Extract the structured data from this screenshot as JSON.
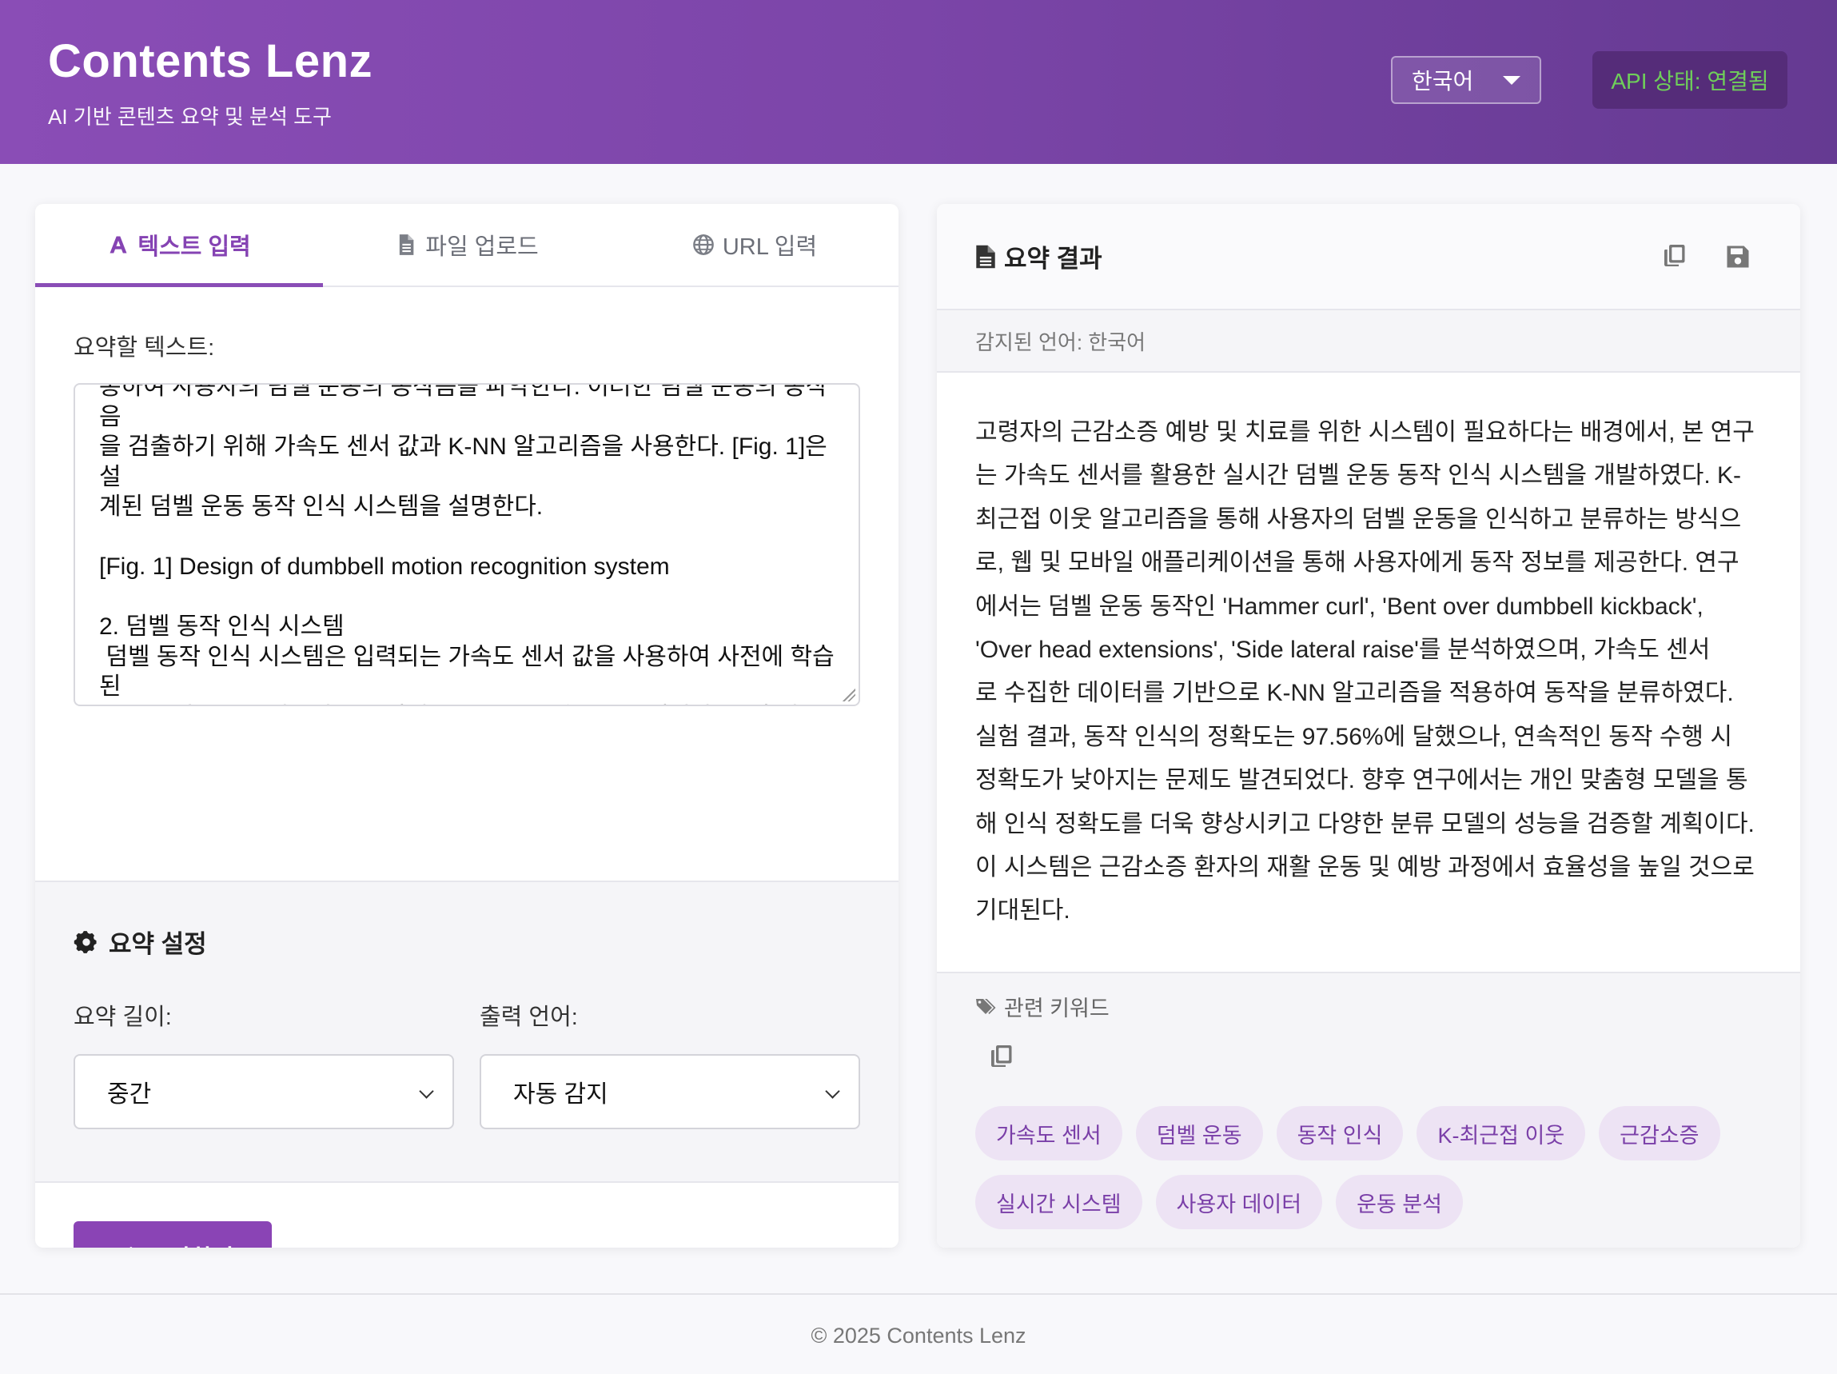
{
  "header": {
    "title": "Contents Lenz",
    "subtitle": "AI 기반 콘텐츠 요약 및 분석 도구",
    "language_selected": "한국어",
    "api_status": "API 상태: 연결됨"
  },
  "tabs": [
    {
      "label": "텍스트 입력",
      "icon": "font-a-icon",
      "active": true
    },
    {
      "label": "파일 업로드",
      "icon": "file-icon",
      "active": false
    },
    {
      "label": "URL 입력",
      "icon": "globe-icon",
      "active": false
    }
  ],
  "input": {
    "label": "요약할 텍스트:",
    "text": "통하여 사용자의 덤벨 운동의 동작음을 파악한다. 이러한 덤벨 운동의 동작음\n을 검출하기 위해 가속도 센서 값과 K-NN 알고리즘을 사용한다. [Fig. 1]은 설\n계된 덤벨 운동 동작 인식 시스템을 설명한다.\n\n[Fig. 1] Design of dumbbell motion recognition system\n\n2. 덤벨 동작 인식 시스템\n 덤벨 동작 인식 시스템은 입력되는 가속도 센서 값을 사용하여 사전에 학습된\n동작을 기준으로 실시간으로 덤벨 동작을 분류하는 시스템이다. 먼저 실시간으\n로 디바이스 부분으로부터 가속도 센서의 값을 전송받는다. 그리고 이 값을 스\n마트폰에서 유저 데이터, 디바이스 데이터와 함께 서버로 재전송한다. 그 후 동\n작 분석을 위한 특징을 계산한다. 계산된 값은 사전에 학습된 동작의 특징 값과"
  },
  "settings": {
    "title": "요약 설정",
    "length_label": "요약 길이:",
    "length_value": "중간",
    "output_lang_label": "출력 언어:",
    "output_lang_value": "자동 감지"
  },
  "actions": {
    "summarize": "요약하기"
  },
  "result": {
    "title": "요약 결과",
    "detected_language": "감지된 언어: 한국어",
    "lines": [
      "고령자의 근감소증 예방 및 치료를 위한 시스템이 필요하다는 배경에서, 본 연구",
      "는 가속도 센서를 활용한 실시간 덤벨 운동 동작 인식 시스템을 개발하였다. K-",
      "최근접 이웃 알고리즘을 통해 사용자의 덤벨 운동을 인식하고 분류하는 방식으",
      "로, 웹 및 모바일 애플리케이션을 통해 사용자에게 동작 정보를 제공한다. 연구",
      "에서는 덤벨 운동 동작인 'Hammer curl', 'Bent over dumbbell kickback',",
      "'Over head extensions', 'Side lateral raise'를 분석하였으며, 가속도 센서",
      "로 수집한 데이터를 기반으로 K-NN 알고리즘을 적용하여 동작을 분류하였다.",
      "실험 결과, 동작 인식의 정확도는 97.56%에 달했으나, 연속적인 동작 수행 시",
      "정확도가 낮아지는 문제도 발견되었다. 향후 연구에서는 개인 맞춤형 모델을 통",
      "해 인식 정확도를 더욱 향상시키고 다양한 분류 모델의 성능을 검증할 계획이다.",
      "이 시스템은 근감소증 환자의 재활 운동 및 예방 과정에서 효율성을 높일 것으로",
      "기대된다."
    ]
  },
  "keywords": {
    "title": "관련 키워드",
    "items": [
      "가속도 센서",
      "덤벨 운동",
      "동작 인식",
      "K-최근접 이웃",
      "근감소증",
      "실시간 시스템",
      "사용자 데이터",
      "운동 분석"
    ]
  },
  "footer": "© 2025 Contents Lenz",
  "colors": {
    "brand": "#8a4db6",
    "brand_dark": "#653a92",
    "api_ok": "#6fcf5a",
    "chip_bg": "#ede3f4",
    "chip_text": "#7a3fa8"
  }
}
